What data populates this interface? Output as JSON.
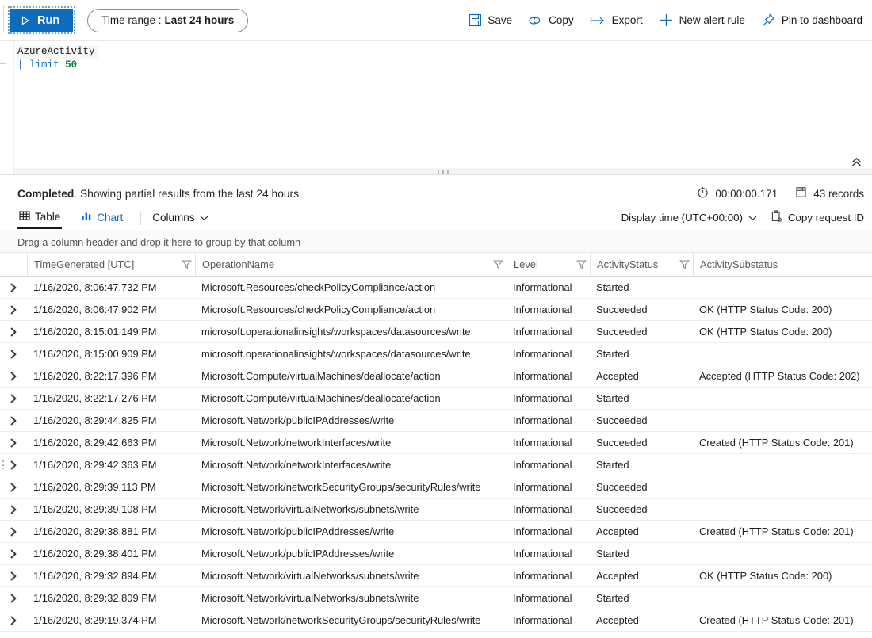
{
  "toolbar": {
    "run_label": "Run",
    "time_range_prefix": "Time range :",
    "time_range_value": "Last 24 hours",
    "actions": [
      {
        "label": "Save",
        "icon": "save-icon"
      },
      {
        "label": "Copy",
        "icon": "copy-link-icon"
      },
      {
        "label": "Export",
        "icon": "export-icon"
      },
      {
        "label": "New alert rule",
        "icon": "plus-icon"
      },
      {
        "label": "Pin to dashboard",
        "icon": "pin-icon"
      }
    ]
  },
  "editor": {
    "line1": "AzureActivity",
    "line2_pipe": "|",
    "line2_op": "limit",
    "line2_num": "50",
    "collapse_icon": "double-chevron-up-icon"
  },
  "results": {
    "status_bold": "Completed",
    "status_rest": ". Showing partial results from the last 24 hours.",
    "duration": "00:00:00.171",
    "duration_icon": "timer-icon",
    "record_count": "43 records",
    "record_icon": "records-icon",
    "tabs": [
      {
        "label": "Table",
        "icon": "table-icon",
        "active": true
      },
      {
        "label": "Chart",
        "icon": "chart-icon",
        "active": false
      }
    ],
    "columns_label": "Columns",
    "display_time_label": "Display time (UTC+00:00)",
    "copy_request_label": "Copy request ID",
    "copy_request_icon": "clipboard-icon"
  },
  "grid": {
    "group_hint": "Drag a column header and drop it here to group by that column",
    "columns": [
      {
        "key": "time",
        "label": "TimeGenerated [UTC]",
        "filter": true
      },
      {
        "key": "op",
        "label": "OperationName",
        "filter": true
      },
      {
        "key": "lvl",
        "label": "Level",
        "filter": true
      },
      {
        "key": "as",
        "label": "ActivityStatus",
        "filter": true
      },
      {
        "key": "asub",
        "label": "ActivitySubstatus",
        "filter": false
      }
    ],
    "rows": [
      {
        "time": "1/16/2020, 8:06:47.732 PM",
        "op": "Microsoft.Resources/checkPolicyCompliance/action",
        "lvl": "Informational",
        "as": "Started",
        "asub": ""
      },
      {
        "time": "1/16/2020, 8:06:47.902 PM",
        "op": "Microsoft.Resources/checkPolicyCompliance/action",
        "lvl": "Informational",
        "as": "Succeeded",
        "asub": "OK (HTTP Status Code: 200)"
      },
      {
        "time": "1/16/2020, 8:15:01.149 PM",
        "op": "microsoft.operationalinsights/workspaces/datasources/write",
        "lvl": "Informational",
        "as": "Succeeded",
        "asub": "OK (HTTP Status Code: 200)"
      },
      {
        "time": "1/16/2020, 8:15:00.909 PM",
        "op": "microsoft.operationalinsights/workspaces/datasources/write",
        "lvl": "Informational",
        "as": "Started",
        "asub": ""
      },
      {
        "time": "1/16/2020, 8:22:17.396 PM",
        "op": "Microsoft.Compute/virtualMachines/deallocate/action",
        "lvl": "Informational",
        "as": "Accepted",
        "asub": "Accepted (HTTP Status Code: 202)"
      },
      {
        "time": "1/16/2020, 8:22:17.276 PM",
        "op": "Microsoft.Compute/virtualMachines/deallocate/action",
        "lvl": "Informational",
        "as": "Started",
        "asub": ""
      },
      {
        "time": "1/16/2020, 8:29:44.825 PM",
        "op": "Microsoft.Network/publicIPAddresses/write",
        "lvl": "Informational",
        "as": "Succeeded",
        "asub": ""
      },
      {
        "time": "1/16/2020, 8:29:42.663 PM",
        "op": "Microsoft.Network/networkInterfaces/write",
        "lvl": "Informational",
        "as": "Succeeded",
        "asub": "Created (HTTP Status Code: 201)"
      },
      {
        "time": "1/16/2020, 8:29:42.363 PM",
        "op": "Microsoft.Network/networkInterfaces/write",
        "lvl": "Informational",
        "as": "Started",
        "asub": ""
      },
      {
        "time": "1/16/2020, 8:29:39.113 PM",
        "op": "Microsoft.Network/networkSecurityGroups/securityRules/write",
        "lvl": "Informational",
        "as": "Succeeded",
        "asub": ""
      },
      {
        "time": "1/16/2020, 8:29:39.108 PM",
        "op": "Microsoft.Network/virtualNetworks/subnets/write",
        "lvl": "Informational",
        "as": "Succeeded",
        "asub": ""
      },
      {
        "time": "1/16/2020, 8:29:38.881 PM",
        "op": "Microsoft.Network/publicIPAddresses/write",
        "lvl": "Informational",
        "as": "Accepted",
        "asub": "Created (HTTP Status Code: 201)"
      },
      {
        "time": "1/16/2020, 8:29:38.401 PM",
        "op": "Microsoft.Network/publicIPAddresses/write",
        "lvl": "Informational",
        "as": "Started",
        "asub": ""
      },
      {
        "time": "1/16/2020, 8:29:32.894 PM",
        "op": "Microsoft.Network/virtualNetworks/subnets/write",
        "lvl": "Informational",
        "as": "Accepted",
        "asub": "OK (HTTP Status Code: 200)"
      },
      {
        "time": "1/16/2020, 8:29:32.809 PM",
        "op": "Microsoft.Network/virtualNetworks/subnets/write",
        "lvl": "Informational",
        "as": "Started",
        "asub": ""
      },
      {
        "time": "1/16/2020, 8:29:19.374 PM",
        "op": "Microsoft.Network/networkSecurityGroups/securityRules/write",
        "lvl": "Informational",
        "as": "Accepted",
        "asub": "Created (HTTP Status Code: 201)"
      }
    ]
  },
  "colors": {
    "accent": "#0f6cbd",
    "keyword": "#0050c0",
    "number": "#0a8043"
  }
}
